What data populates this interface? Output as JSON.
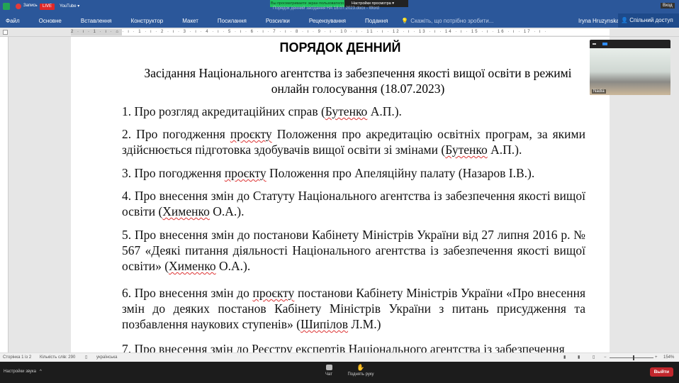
{
  "zoom_top": {
    "recording": "Запись",
    "live": "LIVE",
    "youtube": "YouTube ▾",
    "share_banner": "Вы просматриваете экран пользователя",
    "view_options": "Настройки просмотра ▾",
    "login": "Вход"
  },
  "word": {
    "doc_title": "Порядок денний засідання НА 18.07.2023.docx - Word",
    "tabs": [
      "Файл",
      "Основне",
      "Вставлення",
      "Конструктор",
      "Макет",
      "Посилання",
      "Розсилки",
      "Рецензування",
      "Подання"
    ],
    "tell_me": "Скажіть, що потрібно зробити...",
    "user": "Iryna Hruzynska",
    "share": "Спільний доступ",
    "ruler": "2 · ı · 1 · ı · ⌂ · ı · 1 · ı · 2 · ı · 3 · ı · 4 · ı · 5 · ı · 6 · ı · 7 · ı · 8 · ı · 9 · ı · 10 · ı · 11 · ı · 12 · ı · 13 · ı · 14 · ı · 15 · ı · 16 · ı · 17 · ı ·"
  },
  "document": {
    "title": "ПОРЯДОК ДЕННИЙ",
    "subtitle": "Засідання Національного агентства із забезпечення якості вищої освіти в режимі онлайн голосування (18.07.2023)",
    "items": [
      [
        {
          "t": "1. Про розгляд акредитаційних справ ("
        },
        {
          "t": "Бутенко",
          "u": 1
        },
        {
          "t": " А.П.)."
        }
      ],
      [
        {
          "t": "2. Про погодження "
        },
        {
          "t": "проєкту",
          "u": 1
        },
        {
          "t": " Положення про акредитацію освітніх програм, за якими здійснюється підготовка здобувачів вищої освіти зі змінами ("
        },
        {
          "t": "Бутенко",
          "u": 1
        },
        {
          "t": " А.П.)."
        }
      ],
      [
        {
          "t": "3. Про погодження "
        },
        {
          "t": "проєкту",
          "u": 1
        },
        {
          "t": " Положення про Апеляційну палату (Назаров І.В.)."
        }
      ],
      [
        {
          "t": "4. Про внесення змін до Статуту Національного агентства із забезпечення якості вищої освіти ("
        },
        {
          "t": "Химeнко",
          "u": 1
        },
        {
          "t": " О.А.)."
        }
      ],
      [
        {
          "t": "5. Про внесення змін до постанови Кабінету Міністрів України від 27 липня 2016 р. № 567 «Деякі питання діяльності Національного агентства із забезпечення якості вищої освіти» ("
        },
        {
          "t": "Химeнко",
          "u": 1
        },
        {
          "t": " О.А.)."
        }
      ],
      [
        {
          "t": "6. Про внесення змін до "
        },
        {
          "t": "проєкту",
          "u": 1
        },
        {
          "t": " постанови Кабінету Міністрів України «Про внесення змін до деяких постанов Кабінету Міністрів України з питань присудження та позбавлення наукових ступенів» ("
        },
        {
          "t": "Шипілов",
          "u": 1
        },
        {
          "t": " Л.М.)"
        }
      ],
      [
        {
          "t": "7. Про внесення змін до Реєстру експертів Національного агентства із забезпечення"
        }
      ]
    ]
  },
  "status": {
    "page": "Сторінка 1 із 2",
    "words": "Кількість слів: 290",
    "language": "українська",
    "zoom": "154%"
  },
  "video": {
    "name": "Nadia"
  },
  "meeting": {
    "audio": "Настройки звука",
    "chat": "Чат",
    "raise_hand": "Поднять руку",
    "exit": "Выйти"
  },
  "colors": {
    "word_blue": "#2b579a",
    "live_red": "#e02828",
    "banner_green": "#22c35e",
    "exit_red": "#c1272d"
  }
}
